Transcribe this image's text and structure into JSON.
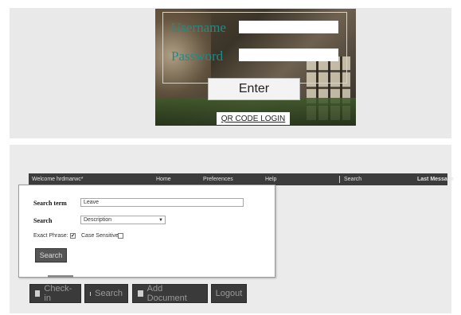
{
  "login": {
    "username_label": "Username",
    "password_label": "Password",
    "enter_label": "Enter",
    "qr_label": "QR CODE LOGIN"
  },
  "nav": {
    "welcome": "Welcome hrdmarwc*",
    "home": "Home",
    "preferences": "Preferences",
    "help": "Help",
    "search": "Search",
    "last_message": "Last Message"
  },
  "search_panel": {
    "term_label": "Search term",
    "term_value": "Leave",
    "search_label": "Search",
    "search_field_value": "Description",
    "exact_phrase_label": "Exact Phrase:",
    "exact_phrase_checked": "✔",
    "case_sensitive_label": "Case Sensitive",
    "button_label": "Search"
  },
  "actions": {
    "checkin": "Check-in",
    "search": "Search",
    "add_document": "Add Document",
    "logout": "Logout"
  }
}
